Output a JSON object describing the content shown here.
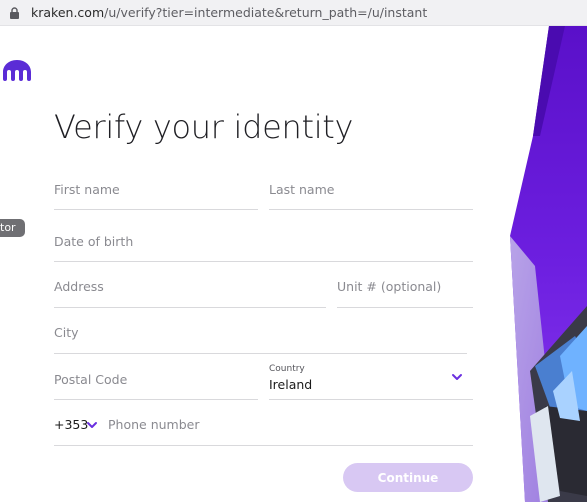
{
  "browser": {
    "url_host": "kraken.com",
    "url_path": "/u/verify?tier=intermediate&return_path=/u/instant"
  },
  "side_tab": {
    "label": "tor"
  },
  "page": {
    "title": "Verify your identity"
  },
  "form": {
    "first_name": {
      "placeholder": "First name"
    },
    "last_name": {
      "placeholder": "Last name"
    },
    "dob": {
      "placeholder": "Date of birth"
    },
    "address": {
      "placeholder": "Address"
    },
    "unit": {
      "placeholder": "Unit # (optional)"
    },
    "city": {
      "placeholder": "City"
    },
    "postal": {
      "placeholder": "Postal Code"
    },
    "country": {
      "label": "Country",
      "value": "Ireland"
    },
    "phone": {
      "country_code": "+353",
      "placeholder": "Phone number"
    },
    "continue_label": "Continue"
  },
  "colors": {
    "brand_purple": "#5741d9",
    "accent_violet": "#7b2ff0",
    "button_disabled": "#d8c8f3"
  },
  "icons": [
    "lock-icon",
    "kraken-logo",
    "chevron-down-icon"
  ]
}
